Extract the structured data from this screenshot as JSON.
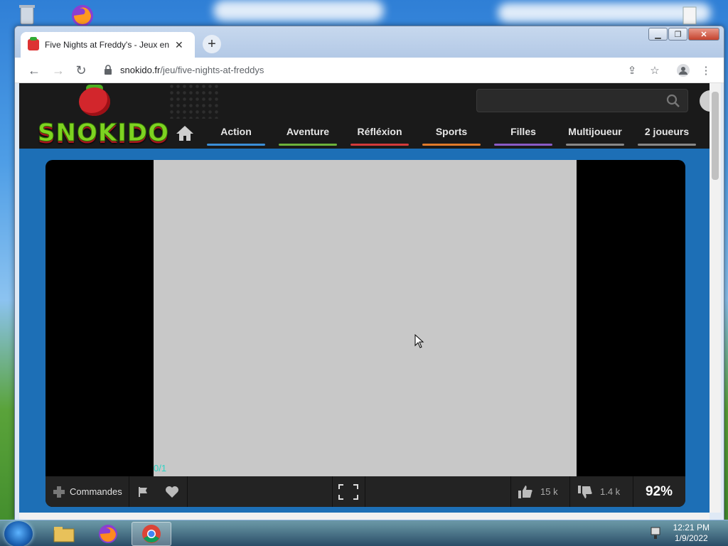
{
  "browser": {
    "tab_title": "Five Nights at Freddy's - Jeux en",
    "url_domain": "snokido.fr",
    "url_path": "/jeu/five-nights-at-freddys"
  },
  "site": {
    "logo_text": "SNOKIDO",
    "nav": [
      {
        "label": "Action",
        "color": "#3b8ed6"
      },
      {
        "label": "Aventure",
        "color": "#6cb23b"
      },
      {
        "label": "Réfléxion",
        "color": "#d23a3a"
      },
      {
        "label": "Sports",
        "color": "#e07a2a"
      },
      {
        "label": "Filles",
        "color": "#8a5bc6"
      },
      {
        "label": "Multijoueur",
        "color": "#888888"
      },
      {
        "label": "2 joueurs",
        "color": "#888888"
      }
    ]
  },
  "game": {
    "counter": "0/1",
    "controls_label": "Commandes",
    "likes": "15 k",
    "dislikes": "1.4 k",
    "rating": "92%"
  },
  "taskbar": {
    "time": "12:21 PM",
    "date": "1/9/2022"
  }
}
